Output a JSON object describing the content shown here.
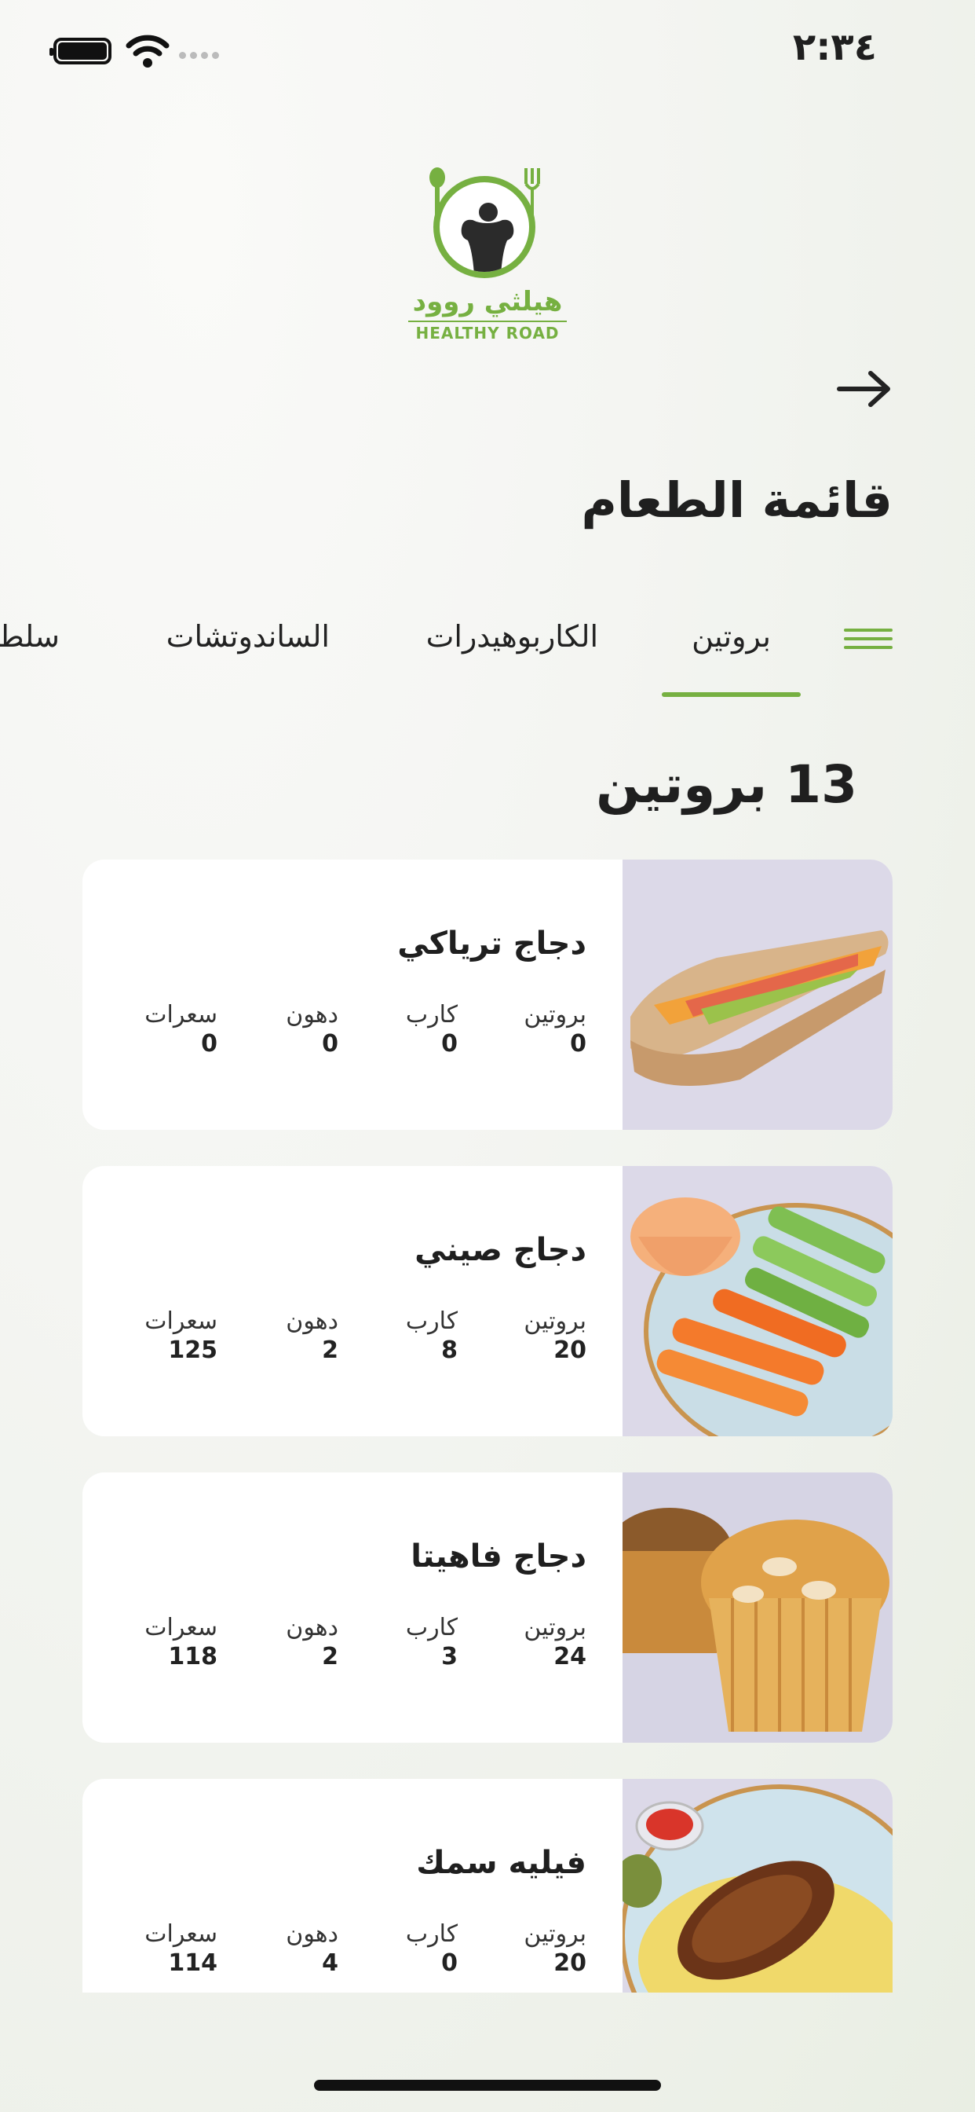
{
  "status_bar": {
    "time": "٢:٣٤"
  },
  "logo": {
    "arabic": "هيلثي روود",
    "english": "HEALTHY ROAD"
  },
  "header": {
    "title": "قائمة الطعام"
  },
  "tabs": [
    {
      "label": "بروتين",
      "active": true
    },
    {
      "label": "الكاربوهيدرات",
      "active": false
    },
    {
      "label": "الساندوتشات",
      "active": false
    },
    {
      "label": "سلطات",
      "active": false
    }
  ],
  "section": {
    "title": "13 بروتين"
  },
  "labels": {
    "protein": "بروتين",
    "carb": "كارب",
    "fat": "دهون",
    "calories": "سعرات"
  },
  "items": [
    {
      "name": "دجاج ترياكي",
      "protein": "0",
      "carb": "0",
      "fat": "0",
      "calories": "0",
      "image": "sandwich-photo"
    },
    {
      "name": "دجاج صيني",
      "protein": "20",
      "carb": "8",
      "fat": "2",
      "calories": "125",
      "image": "veggies-dip-photo"
    },
    {
      "name": "دجاج فاهيتا",
      "protein": "24",
      "carb": "3",
      "fat": "2",
      "calories": "118",
      "image": "muffin-photo"
    },
    {
      "name": "فيليه سمك",
      "protein": "20",
      "carb": "0",
      "fat": "4",
      "calories": "114",
      "image": "fish-rice-photo"
    }
  ],
  "colors": {
    "accent": "#76b041",
    "card": "#ffffff",
    "text": "#1f1f1f"
  }
}
